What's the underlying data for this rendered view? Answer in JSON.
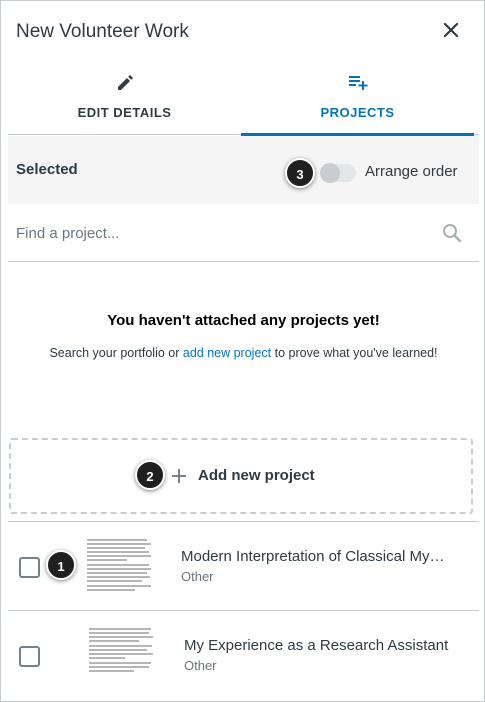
{
  "header": {
    "title": "New Volunteer Work",
    "close_icon": "close-icon"
  },
  "tabs": [
    {
      "label": "EDIT DETAILS",
      "icon": "pencil-icon",
      "active": false
    },
    {
      "label": "PROJECTS",
      "icon": "playlist-add-icon",
      "active": true
    }
  ],
  "selected_bar": {
    "label": "Selected",
    "arrange_label": "Arrange order",
    "arrange_on": false
  },
  "search": {
    "placeholder": "Find a project..."
  },
  "empty_state": {
    "title": "You haven't attached any projects yet!",
    "desc_before": "Search your portfolio or ",
    "link": "add new project",
    "desc_after": " to prove what you've learned!"
  },
  "add_new": {
    "label": "Add new project"
  },
  "projects": [
    {
      "title": "Modern Interpretation of Classical My…",
      "type": "Other"
    },
    {
      "title": "My Experience as a Research Assistant",
      "type": "Other"
    }
  ],
  "callouts": [
    "1",
    "2",
    "3"
  ],
  "colors": {
    "accent": "#0374b5",
    "text": "#2d3b45",
    "muted": "#6b7780",
    "border": "#c7cdd1",
    "callout_bg": "#1f1f1f"
  }
}
